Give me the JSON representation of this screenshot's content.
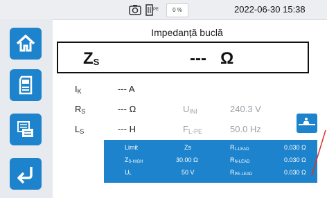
{
  "status_bar": {
    "camera_icon": "camera-icon",
    "plug_icon": "plug-lnpe-icon",
    "battery_percent": "0 %",
    "battery_level": 0,
    "datetime": "2022-06-30  15:38"
  },
  "sidebar": {
    "items": [
      {
        "name": "home",
        "icon": "home-icon"
      },
      {
        "name": "memory",
        "icon": "sd-card-icon"
      },
      {
        "name": "notes",
        "icon": "notes-icon"
      },
      {
        "name": "back",
        "icon": "back-arrow-icon"
      }
    ]
  },
  "screen_title": "Impedanță buclă",
  "main_result": {
    "label": "Z",
    "label_sub": "S",
    "value": "---",
    "unit": "Ω"
  },
  "measurements": {
    "ik": {
      "label": "I",
      "sub": "K",
      "value": "--- A"
    },
    "rs": {
      "label": "R",
      "sub": "S",
      "value": "--- Ω"
    },
    "ls": {
      "label": "L",
      "sub": "S",
      "value": "--- H"
    },
    "uini": {
      "label": "U",
      "sub": "INI",
      "value": "240.3 V"
    },
    "flpe": {
      "label": "F",
      "sub": "L-PE",
      "value": "50.0 Hz"
    }
  },
  "parameters": {
    "limit_label": "Limit",
    "zs_label": "Zs",
    "zs_high_label": "Z",
    "zs_high_sub": "S-HIGH",
    "zs_high_value": "30.00 Ω",
    "ul_label": "U",
    "ul_sub": "L",
    "ul_value": "50 V",
    "rl_lead_label": "R",
    "rl_lead_sub": "L-LEAD",
    "rl_lead_value": "0.030 Ω",
    "rn_lead_label": "R",
    "rn_lead_sub": "N-LEAD",
    "rn_lead_value": "0.030 Ω",
    "rpe_lead_label": "R",
    "rpe_lead_sub": "PE-LEAD",
    "rpe_lead_value": "0.030 Ω"
  },
  "lead_button_icon": "lead-compensation-icon",
  "colors": {
    "accent": "#1d83cc",
    "sidebar_bg": "#e7eaee",
    "topbar_bg": "#eceef2",
    "inactive_text": "#9aa0a6"
  }
}
